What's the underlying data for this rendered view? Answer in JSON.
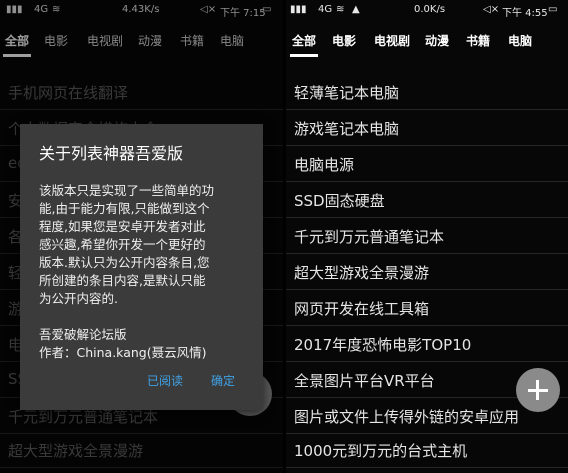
{
  "left": {
    "status": {
      "network": "4G",
      "speed": "4.43K/s",
      "time": "下午 7:15"
    },
    "tabs": [
      "全部",
      "电影",
      "电视剧",
      "动漫",
      "书籍",
      "电脑"
    ],
    "items": [
      "手机网页在线翻译",
      "个人数据安全措施大全",
      "ed",
      "安",
      "各",
      "轻",
      "游",
      "电",
      "SS",
      "千元到万元普通笔记本",
      "超大型游戏全景漫游"
    ],
    "dialog": {
      "title": "关于列表神器吾爱版",
      "body_lines": [
        "该版本只是实现了一些简单的功",
        "能,由于能力有限,只能做到这个",
        "程度,如果您是安卓开发者对此",
        "感兴趣,希望你开发一个更好的",
        "版本.默认只为公开内容条目,您",
        "所创建的条目内容,是默认只能",
        "为公开内容的."
      ],
      "credit_lines": [
        "吾爱破解论坛版",
        "作者：China.kang(聂云风情)"
      ],
      "btn_read": "已阅读",
      "btn_ok": "确定"
    }
  },
  "right": {
    "status": {
      "network": "4G",
      "speed": "0.0K/s",
      "time": "下午 4:55"
    },
    "tabs": [
      "全部",
      "电影",
      "电视剧",
      "动漫",
      "书籍",
      "电脑"
    ],
    "items": [
      "轻薄笔记本电脑",
      "游戏笔记本电脑",
      "电脑电源",
      "SSD固态硬盘",
      "千元到万元普通笔记本",
      "超大型游戏全景漫游",
      "网页开发在线工具箱",
      "2017年度恐怖电影TOP10",
      "全景图片平台VR平台",
      "图片或文件上传得外链的安卓应用",
      "1000元到万元的台式主机"
    ]
  },
  "colors": {
    "accent": "#3fa2e6",
    "dialog_bg": "#3b3b3b",
    "fab": "#8a8a8a"
  }
}
